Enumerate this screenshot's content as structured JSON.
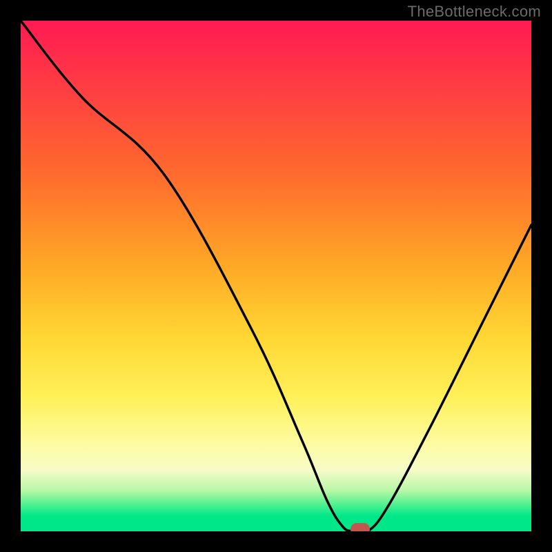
{
  "watermark": "TheBottleneck.com",
  "colors": {
    "frame": "#000000",
    "watermark_text": "#6b6b6b",
    "curve_stroke": "#000000",
    "marker_fill": "#c1574e"
  },
  "plot": {
    "inner_left": 30,
    "inner_top": 30,
    "inner_width": 740,
    "inner_height": 740
  },
  "chart_data": {
    "type": "line",
    "title": "",
    "xlabel": "",
    "ylabel": "",
    "xlim": [
      0,
      100
    ],
    "ylim": [
      0,
      100
    ],
    "grid": false,
    "legend": false,
    "series": [
      {
        "name": "bottleneck-curve",
        "x": [
          0,
          12,
          28,
          45,
          55,
          60,
          63,
          65,
          68,
          72,
          80,
          90,
          100
        ],
        "values": [
          100,
          85,
          70,
          40,
          18,
          6,
          1,
          0,
          0,
          5,
          20,
          40,
          60
        ]
      }
    ],
    "annotations": [
      {
        "name": "min-marker",
        "x": 66.5,
        "y": 0
      }
    ],
    "gradient_stops": [
      {
        "pos": 0,
        "color": "#ff1a52"
      },
      {
        "pos": 12,
        "color": "#ff3a44"
      },
      {
        "pos": 30,
        "color": "#ff6a2d"
      },
      {
        "pos": 48,
        "color": "#ffa826"
      },
      {
        "pos": 62,
        "color": "#ffd733"
      },
      {
        "pos": 74,
        "color": "#fff15a"
      },
      {
        "pos": 83,
        "color": "#fdfca3"
      },
      {
        "pos": 88,
        "color": "#f6fcc8"
      },
      {
        "pos": 92,
        "color": "#b8f7a7"
      },
      {
        "pos": 95,
        "color": "#47f08e"
      },
      {
        "pos": 97,
        "color": "#00e789"
      },
      {
        "pos": 100,
        "color": "#00e789"
      }
    ]
  }
}
